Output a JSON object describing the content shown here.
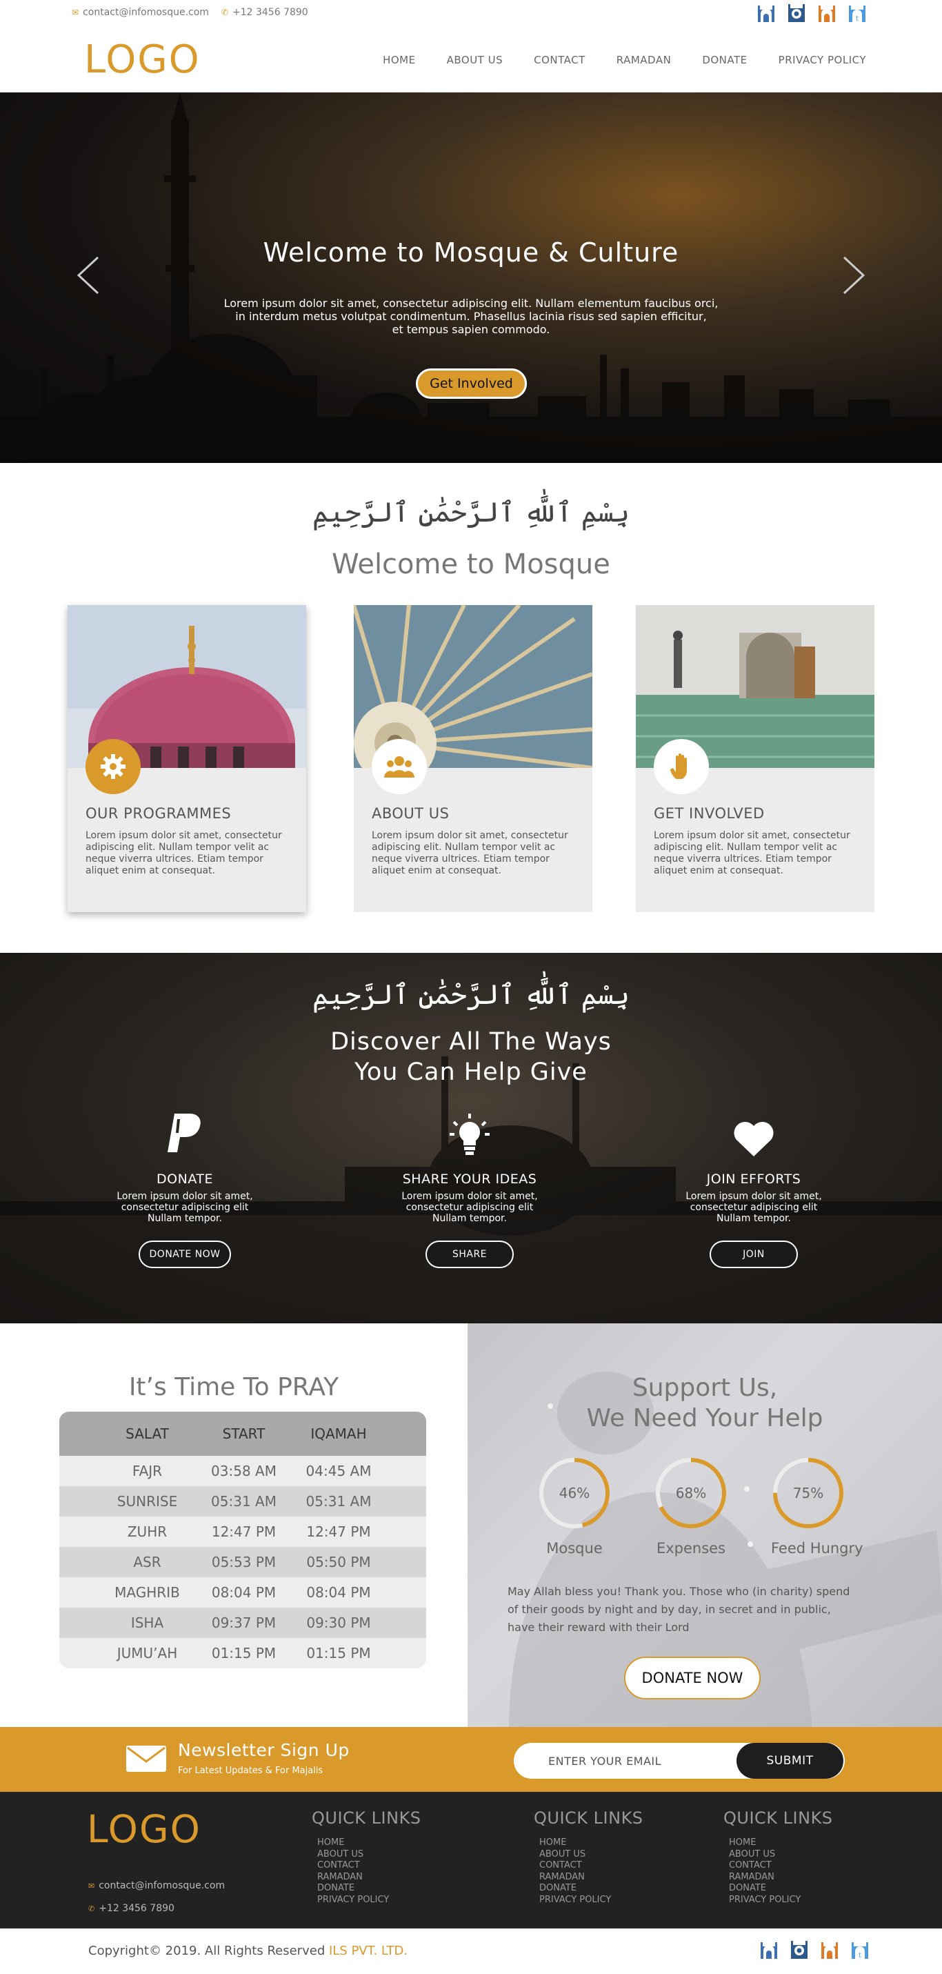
{
  "topbar": {
    "email": "contact@infomosque.com",
    "phone": "+12 3456 7890",
    "social_icons": [
      "mosque-icon-blue",
      "mosque-icon-navy",
      "mosque-icon-orange",
      "mosque-icon-lightblue"
    ]
  },
  "header": {
    "logo": "LOGO",
    "nav": [
      "HOME",
      "ABOUT US",
      "CONTACT",
      "RAMADAN",
      "DONATE",
      "PRIVACY POLICY"
    ]
  },
  "hero": {
    "title": "Welcome to Mosque & Culture",
    "text_l1": "Lorem ipsum dolor sit amet, consectetur adipiscing elit. Nullam elementum faucibus orci,",
    "text_l2": "in interdum metus volutpat condimentum. Phasellus lacinia risus sed sapien efficitur,",
    "text_l3": "et tempus sapien commodo.",
    "cta": "Get Involved"
  },
  "welcome": {
    "calligraphy": "بِسْمِ ٱللَّٰهِ ٱلرَّحْمَٰنِ ٱلرَّحِيمِ",
    "title": "Welcome to Mosque",
    "cards": [
      {
        "title": "OUR PROGRAMMES",
        "text": "Lorem ipsum dolor sit amet, consectetur adipiscing elit. Nullam tempor velit ac neque viverra ultrices. Etiam tempor aliquet enim at consequat.",
        "icon": "gear-icon"
      },
      {
        "title": "ABOUT US",
        "text": "Lorem ipsum dolor sit amet, consectetur adipiscing elit. Nullam tempor velit ac neque viverra ultrices. Etiam tempor aliquet enim at consequat.",
        "icon": "group-icon"
      },
      {
        "title": "GET INVOLVED",
        "text": "Lorem ipsum dolor sit amet, consectetur adipiscing elit. Nullam tempor velit ac neque viverra ultrices. Etiam tempor aliquet enim at consequat.",
        "icon": "hand-icon"
      }
    ]
  },
  "discover": {
    "calligraphy": "بِسْمِ ٱللَّٰهِ ٱلرَّحْمَٰنِ ٱلرَّحِيمِ",
    "title_l1": "Discover All The Ways",
    "title_l2": "You Can Help Give",
    "ways": [
      {
        "title": "DONATE",
        "l1": "Lorem ipsum dolor sit amet,",
        "l2": "consectetur adipiscing elit",
        "l3": "Nullam tempor.",
        "button": "DONATE NOW",
        "icon": "paypal-icon"
      },
      {
        "title": "SHARE YOUR IDEAS",
        "l1": "Lorem ipsum dolor sit amet,",
        "l2": "consectetur adipiscing elit",
        "l3": "Nullam tempor.",
        "button": "SHARE",
        "icon": "lightbulb-icon"
      },
      {
        "title": "JOIN EFFORTS",
        "l1": "Lorem ipsum dolor sit amet,",
        "l2": "consectetur adipiscing elit",
        "l3": "Nullam tempor.",
        "button": "JOIN",
        "icon": "heart-icon"
      }
    ]
  },
  "prayer": {
    "title": "It’s Time To PRAY",
    "headers": [
      "SALAT",
      "START",
      "IQAMAH"
    ],
    "rows": [
      [
        "FAJR",
        "03:58 AM",
        "04:45 AM"
      ],
      [
        "SUNRISE",
        "05:31 AM",
        "05:31 AM"
      ],
      [
        "ZUHR",
        "12:47 PM",
        "12:47 PM"
      ],
      [
        "ASR",
        "05:53 PM",
        "05:50 PM"
      ],
      [
        "MAGHRIB",
        "08:04 PM",
        "08:04 PM"
      ],
      [
        "ISHA",
        "09:37 PM",
        "09:30 PM"
      ],
      [
        "JUMU’AH",
        "01:15 PM",
        "01:15 PM"
      ]
    ]
  },
  "support": {
    "title_l1": "Support Us,",
    "title_l2": "We Need Your Help",
    "progress": [
      {
        "label": "Mosque",
        "value": 46,
        "text": "46%"
      },
      {
        "label": "Expenses",
        "value": 68,
        "text": "68%"
      },
      {
        "label": "Feed Hungry",
        "value": 75,
        "text": "75%"
      }
    ],
    "quote_l1": "May Allah bless you! Thank you. Those who (in charity) spend",
    "quote_l2": "of their goods by night and by day, in secret and in public,",
    "quote_l3": "have their reward with their Lord",
    "button": "DONATE NOW"
  },
  "newsletter": {
    "title": "Newsletter Sign Up",
    "subtitle": "For Latest Updates & For Majalis",
    "placeholder": "ENTER YOUR EMAIL",
    "submit": "SUBMIT"
  },
  "footer": {
    "logo": "LOGO",
    "email": "contact@infomosque.com",
    "phone": "+12 3456 7890",
    "columns": [
      {
        "title": "QUICK LINKS",
        "links": [
          "HOME",
          "ABOUT US",
          "CONTACT",
          "RAMADAN",
          "DONATE",
          "PRIVACY POLICY"
        ]
      },
      {
        "title": "QUICK LINKS",
        "links": [
          "HOME",
          "ABOUT US",
          "CONTACT",
          "RAMADAN",
          "DONATE",
          "PRIVACY POLICY"
        ]
      },
      {
        "title": "QUICK LINKS",
        "links": [
          "HOME",
          "ABOUT US",
          "CONTACT",
          "RAMADAN",
          "DONATE",
          "PRIVACY POLICY"
        ]
      }
    ],
    "copyright": "Copyright© 2019. All Rights Reserved ",
    "company": "ILS PVT. LTD."
  },
  "colors": {
    "accent": "#d99a2b",
    "dark": "#222223"
  }
}
